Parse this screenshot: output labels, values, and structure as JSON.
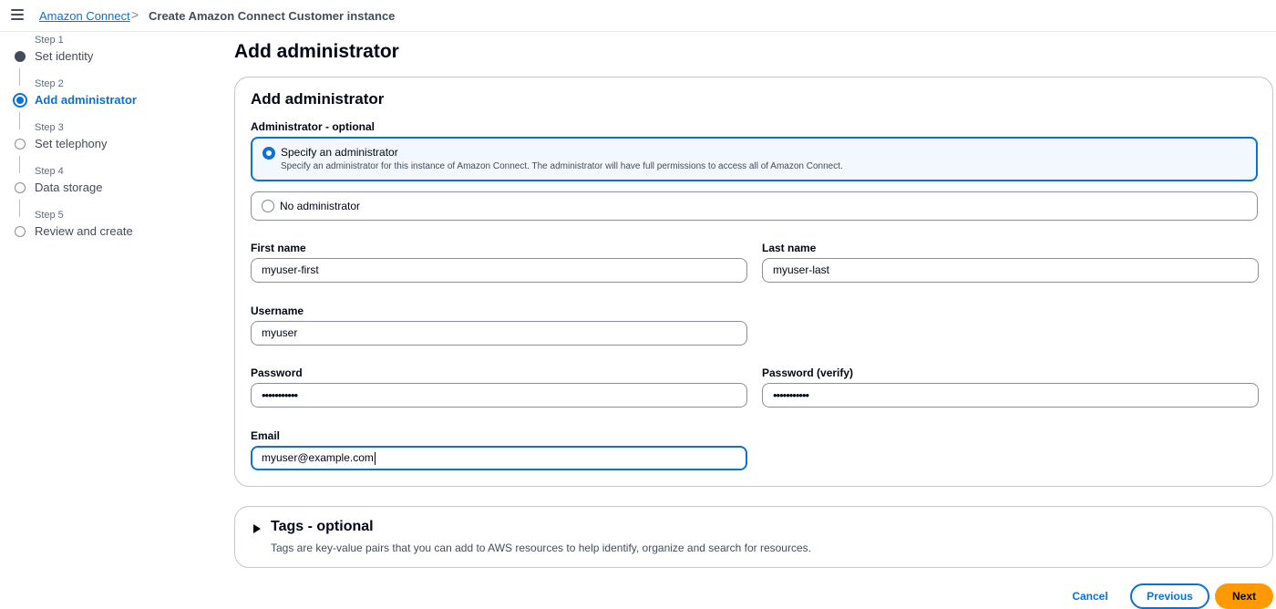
{
  "colors": {
    "accent": "#0972d3",
    "primary_button": "#ff9900",
    "text": "#000716",
    "border": "#8c8c94"
  },
  "header": {
    "menu_icon": "hamburger-menu-icon",
    "breadcrumb_link": "Amazon Connect",
    "breadcrumb_separator": ">",
    "breadcrumb_current": "Create Amazon Connect Customer instance"
  },
  "steps": [
    {
      "number": "Step 1",
      "label": "Set identity",
      "state": "completed"
    },
    {
      "number": "Step 2",
      "label": "Add administrator",
      "state": "current"
    },
    {
      "number": "Step 3",
      "label": "Set telephony",
      "state": "upcoming"
    },
    {
      "number": "Step 4",
      "label": "Data storage",
      "state": "upcoming"
    },
    {
      "number": "Step 5",
      "label": "Review and create",
      "state": "upcoming"
    }
  ],
  "page_title": "Add administrator",
  "admin_section": {
    "title": "Add administrator",
    "group_label": "Administrator - optional",
    "options": [
      {
        "label": "Specify an administrator",
        "description": "Specify an administrator for this instance of Amazon Connect. The administrator will have full permissions to access all of Amazon Connect.",
        "selected": true
      },
      {
        "label": "No administrator",
        "selected": false
      }
    ],
    "fields": {
      "first_name": {
        "label": "First name",
        "value": "myuser-first"
      },
      "last_name": {
        "label": "Last name",
        "value": "myuser-last"
      },
      "username": {
        "label": "Username",
        "value": "myuser"
      },
      "password": {
        "label": "Password",
        "value": "•••••••••••"
      },
      "password_verify": {
        "label": "Password (verify)",
        "value": "•••••••••••"
      },
      "email": {
        "label": "Email",
        "value": "myuser@example.com"
      }
    }
  },
  "tags_section": {
    "title": "Tags - optional",
    "description": "Tags are key-value pairs that you can add to AWS resources to help identify, organize and search for resources.",
    "expanded": false
  },
  "footer": {
    "cancel": "Cancel",
    "previous": "Previous",
    "next": "Next"
  }
}
